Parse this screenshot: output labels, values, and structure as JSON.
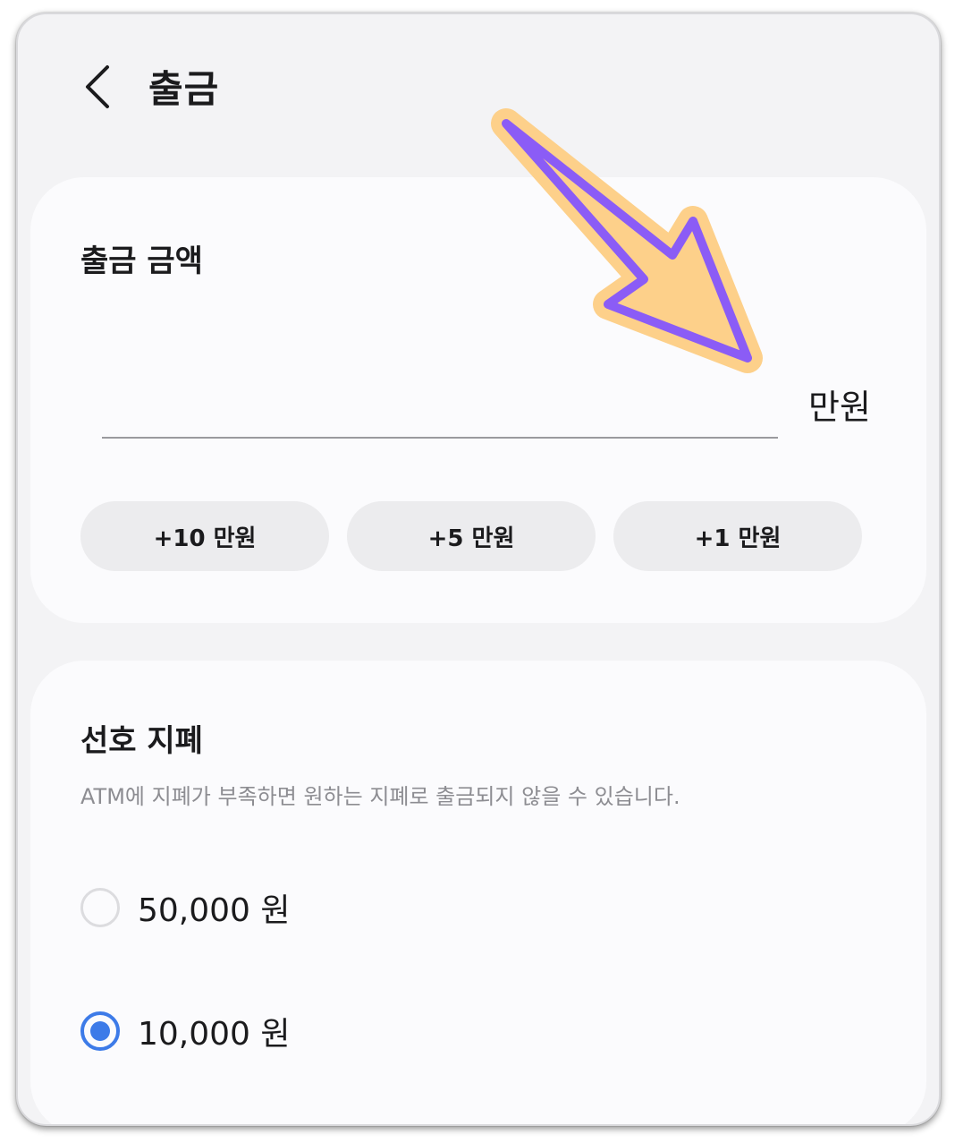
{
  "header": {
    "title": "출금"
  },
  "amount_section": {
    "title": "출금 금액",
    "input_value": "",
    "unit": "만원",
    "quick_buttons": [
      "+10 만원",
      "+5 만원",
      "+1 만원"
    ]
  },
  "notes_section": {
    "title": "선호 지폐",
    "description": "ATM에 지폐가 부족하면 원하는 지폐로 출금되지 않을 수 있습니다.",
    "options": [
      {
        "label": "50,000 원",
        "selected": false
      },
      {
        "label": "10,000 원",
        "selected": true
      }
    ]
  },
  "colors": {
    "accent": "#3d7be8",
    "annotation_arrow_fill": "#fdd08a",
    "annotation_arrow_stroke": "#8b5cf6"
  },
  "icons": {
    "back": "chevron-left-icon",
    "annotation": "arrow-annotation-icon"
  }
}
